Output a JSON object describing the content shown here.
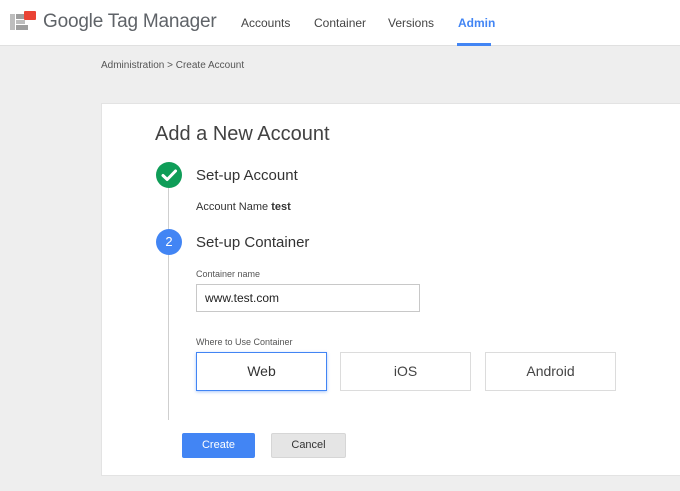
{
  "header": {
    "brand": "Google Tag Manager",
    "logo_icon": "gtm-logo-icon",
    "nav": [
      {
        "label": "Accounts",
        "active": false
      },
      {
        "label": "Container",
        "active": false
      },
      {
        "label": "Versions",
        "active": false
      },
      {
        "label": "Admin",
        "active": true
      }
    ],
    "accent_color": "#4285f4"
  },
  "breadcrumb": "Administration > Create Account",
  "page_title": "Add a New Account",
  "steps": [
    {
      "title": "Set-up Account",
      "status": "complete",
      "icon": "check-icon",
      "color": "#0f9d58",
      "detail_label": "Account Name",
      "detail_value": "test"
    },
    {
      "number": "2",
      "title": "Set-up Container",
      "status": "active",
      "color": "#4285f4"
    }
  ],
  "container_form": {
    "name_label": "Container name",
    "name_value": "www.test.com",
    "usage_label": "Where to Use Container",
    "platforms": [
      {
        "label": "Web",
        "selected": true
      },
      {
        "label": "iOS",
        "selected": false
      },
      {
        "label": "Android",
        "selected": false
      }
    ]
  },
  "actions": {
    "create_label": "Create",
    "cancel_label": "Cancel"
  }
}
